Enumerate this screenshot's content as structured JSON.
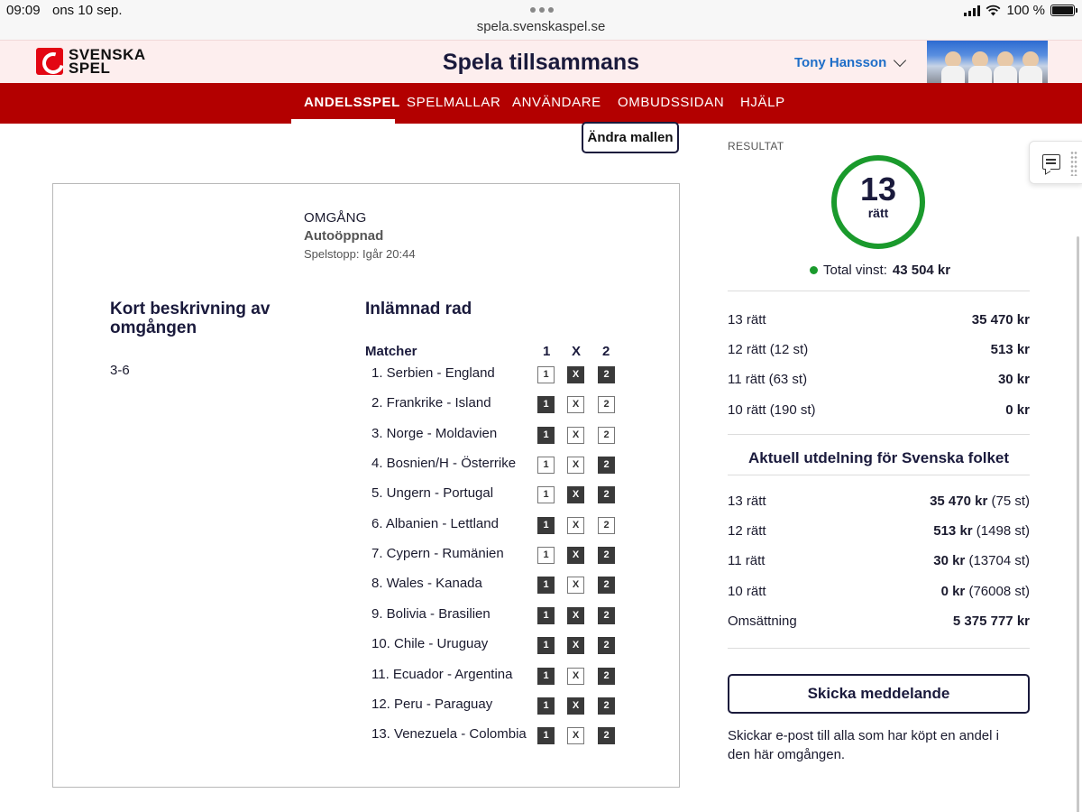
{
  "status_bar": {
    "time": "09:09",
    "date": "ons 10 sep.",
    "url": "spela.svenskaspel.se",
    "battery": "100 %",
    "battery_level": 1.0
  },
  "header": {
    "logo_line1": "SVENSKA",
    "logo_line2": "SPEL",
    "title": "Spela tillsammans",
    "user_name": "Tony Hansson",
    "brand_color": "#b30000"
  },
  "nav": {
    "items": [
      {
        "label": "ANDELSSPEL",
        "active": true
      },
      {
        "label": "SPELMALLAR",
        "active": false
      },
      {
        "label": "ANVÄNDARE",
        "active": false
      },
      {
        "label": "OMBUDSSIDAN",
        "active": false
      },
      {
        "label": "HJÄLP",
        "active": false
      }
    ]
  },
  "main": {
    "change_template_button": "Ändra mallen",
    "round_label": "OMGÅNG",
    "round_status": "Autoöppnad",
    "round_stop": "Spelstopp: Igår 20:44",
    "description_heading": "Kort beskrivning av omgången",
    "description_text": "3-6",
    "rows_heading": "Inlämnad rad",
    "columns": {
      "matches": "Matcher",
      "c1": "1",
      "cx": "X",
      "c2": "2"
    },
    "matches": [
      {
        "name": "1. Serbien - England",
        "sel": [
          false,
          true,
          true
        ]
      },
      {
        "name": "2. Frankrike - Island",
        "sel": [
          true,
          false,
          false
        ]
      },
      {
        "name": "3. Norge - Moldavien",
        "sel": [
          true,
          false,
          false
        ]
      },
      {
        "name": "4. Bosnien/H - Österrike",
        "sel": [
          false,
          false,
          true
        ]
      },
      {
        "name": "5. Ungern - Portugal",
        "sel": [
          false,
          true,
          true
        ]
      },
      {
        "name": "6. Albanien - Lettland",
        "sel": [
          true,
          false,
          false
        ]
      },
      {
        "name": "7. Cypern - Rumänien",
        "sel": [
          false,
          true,
          true
        ]
      },
      {
        "name": "8. Wales - Kanada",
        "sel": [
          true,
          false,
          true
        ]
      },
      {
        "name": "9. Bolivia - Brasilien",
        "sel": [
          true,
          true,
          true
        ]
      },
      {
        "name": "10. Chile - Uruguay",
        "sel": [
          true,
          true,
          true
        ]
      },
      {
        "name": "11. Ecuador - Argentina",
        "sel": [
          true,
          false,
          true
        ]
      },
      {
        "name": "12. Peru - Paraguay",
        "sel": [
          true,
          true,
          true
        ]
      },
      {
        "name": "13. Venezuela - Colombia",
        "sel": [
          true,
          false,
          true
        ]
      }
    ]
  },
  "results": {
    "label": "RESULTAT",
    "correct_number": "13",
    "correct_label": "rätt",
    "total_win_label": "Total vinst:",
    "total_win_value": "43 504 kr",
    "payouts": [
      {
        "label": "13 rätt",
        "value": "35 470 kr"
      },
      {
        "label": "12 rätt (12 st)",
        "value": "513 kr"
      },
      {
        "label": "11 rätt (63 st)",
        "value": "30 kr"
      },
      {
        "label": "10 rätt (190 st)",
        "value": "0 kr"
      }
    ],
    "distribution_heading": "Aktuell utdelning för Svenska folket",
    "distribution": [
      {
        "label": "13 rätt",
        "value": "35 470 kr",
        "count": "(75 st)"
      },
      {
        "label": "12 rätt",
        "value": "513 kr",
        "count": "(1498 st)"
      },
      {
        "label": "11 rätt",
        "value": "30 kr",
        "count": "(13704 st)"
      },
      {
        "label": "10 rätt",
        "value": "0 kr",
        "count": "(76008 st)"
      },
      {
        "label": "Omsättning",
        "value": "5 375 777 kr",
        "count": ""
      }
    ],
    "send_message_button": "Skicka meddelande",
    "send_message_note": "Skickar e-post till alla som har köpt en andel i den här omgången.",
    "success_color": "#1a9a2c"
  }
}
